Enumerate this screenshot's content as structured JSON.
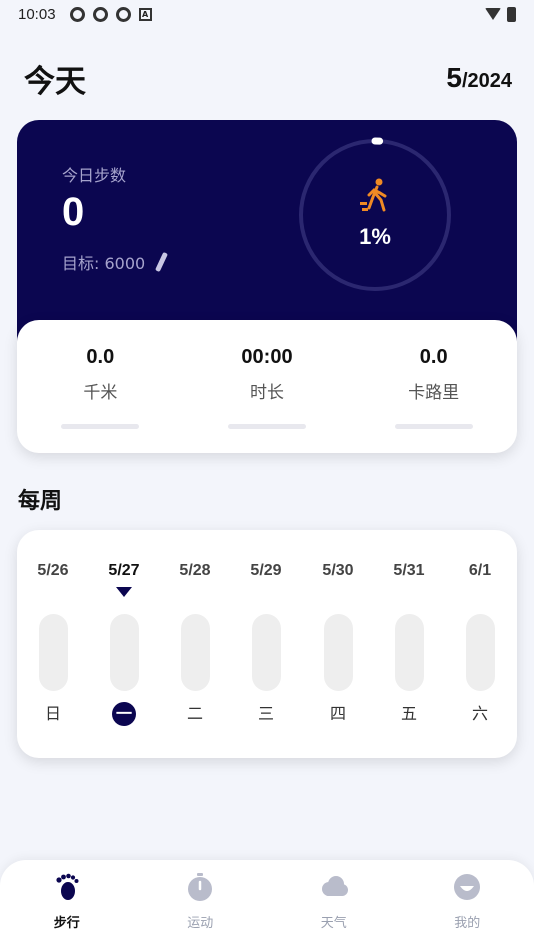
{
  "status_bar": {
    "time": "10:03"
  },
  "header": {
    "title": "今天",
    "date_month": "5",
    "date_year": "/2024"
  },
  "steps": {
    "label": "今日步数",
    "value": "0",
    "goal": "目标: 6000",
    "percent_text": "1%",
    "progress_fraction": 0.01
  },
  "stats": [
    {
      "value": "0.0",
      "label": "千米"
    },
    {
      "value": "00:00",
      "label": "时长"
    },
    {
      "value": "0.0",
      "label": "卡路里"
    }
  ],
  "weekly": {
    "title": "每周",
    "days": [
      {
        "date": "5/26",
        "name": "日"
      },
      {
        "date": "5/27",
        "name": "一"
      },
      {
        "date": "5/28",
        "name": "二"
      },
      {
        "date": "5/29",
        "name": "三"
      },
      {
        "date": "5/30",
        "name": "四"
      },
      {
        "date": "5/31",
        "name": "五"
      },
      {
        "date": "6/1",
        "name": "六"
      }
    ],
    "selected_day": "5/27"
  },
  "nav": [
    {
      "label": "步行",
      "icon": "footprint-icon",
      "active": true
    },
    {
      "label": "运动",
      "icon": "stopwatch-icon",
      "active": false
    },
    {
      "label": "天气",
      "icon": "cloud-icon",
      "active": false
    },
    {
      "label": "我的",
      "icon": "profile-icon",
      "active": false
    }
  ],
  "colors": {
    "primary": "#0b0650",
    "accent": "#f08a24",
    "background": "#f3f5fb"
  }
}
